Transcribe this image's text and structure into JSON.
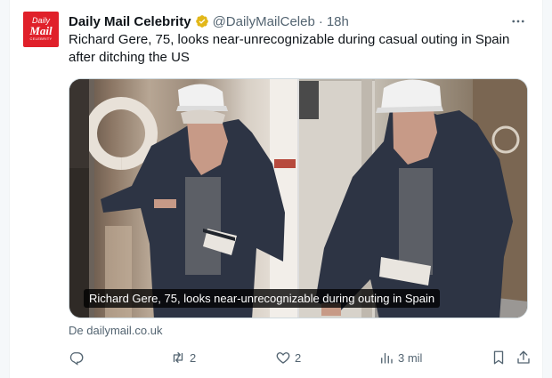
{
  "tweet": {
    "avatar_line1": "Daily",
    "avatar_line2": "Mail",
    "avatar_line3": "CELEBRITY",
    "author_name": "Daily Mail Celebrity",
    "handle": "@DailyMailCeleb",
    "separator": "·",
    "time": "18h",
    "text": "Richard Gere, 75, looks near-unrecognizable during casual outing in Spain after ditching the US",
    "card_caption": "Richard Gere, 75, looks near-unrecognizable during outing in Spain",
    "source": "De dailymail.co.uk"
  },
  "actions": {
    "reply_count": "",
    "retweet_count": "2",
    "like_count": "2",
    "views_count": "3 mil"
  },
  "icons": {
    "verified": "verified-badge-icon",
    "more": "more-icon",
    "reply": "reply-icon",
    "retweet": "retweet-icon",
    "like": "like-icon",
    "views": "views-icon",
    "bookmark": "bookmark-icon",
    "share": "share-icon"
  },
  "colors": {
    "brand_red": "#e0202a",
    "verified_gold": "#e2b719",
    "muted": "#536471"
  }
}
